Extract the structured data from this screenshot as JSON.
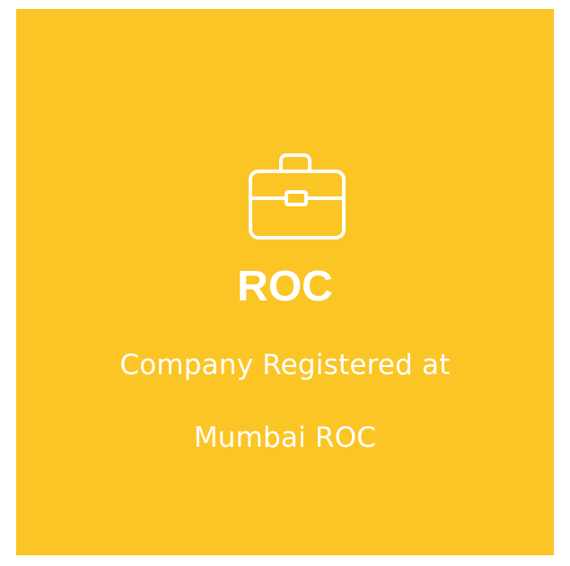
{
  "card": {
    "background_color": "#fbc526",
    "text_color": "#ffffff",
    "icon": "briefcase-icon",
    "title": "ROC",
    "description_line1": "Company Registered at",
    "description_line2": "Mumbai ROC"
  }
}
